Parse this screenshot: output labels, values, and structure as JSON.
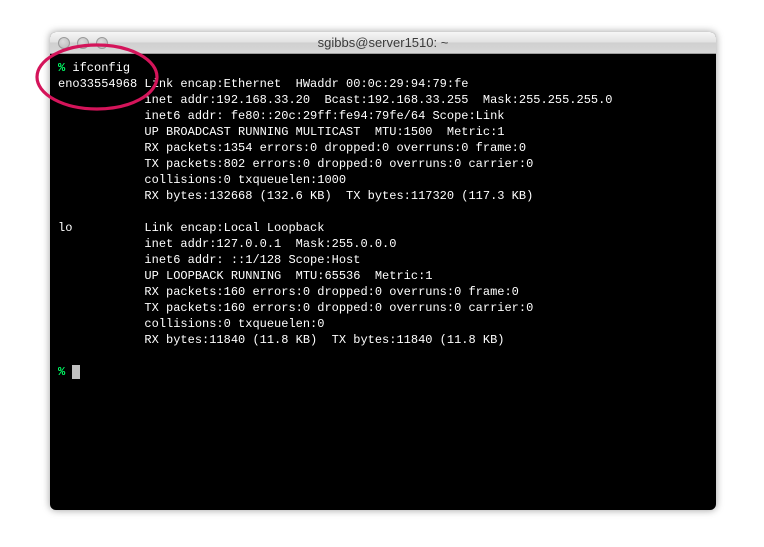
{
  "window": {
    "title": "sgibbs@server1510: ~"
  },
  "prompt": {
    "symbol": "%"
  },
  "command": "ifconfig",
  "iface1": {
    "name": "eno33554968",
    "l1": "Link encap:Ethernet  HWaddr 00:0c:29:94:79:fe",
    "l2": "inet addr:192.168.33.20  Bcast:192.168.33.255  Mask:255.255.255.0",
    "l3": "inet6 addr: fe80::20c:29ff:fe94:79fe/64 Scope:Link",
    "l4": "UP BROADCAST RUNNING MULTICAST  MTU:1500  Metric:1",
    "l5": "RX packets:1354 errors:0 dropped:0 overruns:0 frame:0",
    "l6": "TX packets:802 errors:0 dropped:0 overruns:0 carrier:0",
    "l7": "collisions:0 txqueuelen:1000",
    "l8": "RX bytes:132668 (132.6 KB)  TX bytes:117320 (117.3 KB)"
  },
  "iface2": {
    "name": "lo",
    "l1": "Link encap:Local Loopback",
    "l2": "inet addr:127.0.0.1  Mask:255.0.0.0",
    "l3": "inet6 addr: ::1/128 Scope:Host",
    "l4": "UP LOOPBACK RUNNING  MTU:65536  Metric:1",
    "l5": "RX packets:160 errors:0 dropped:0 overruns:0 frame:0",
    "l6": "TX packets:160 errors:0 dropped:0 overruns:0 carrier:0",
    "l7": "collisions:0 txqueuelen:0",
    "l8": "RX bytes:11840 (11.8 KB)  TX bytes:11840 (11.8 KB)"
  },
  "annotation": {
    "color": "#d4145a"
  }
}
